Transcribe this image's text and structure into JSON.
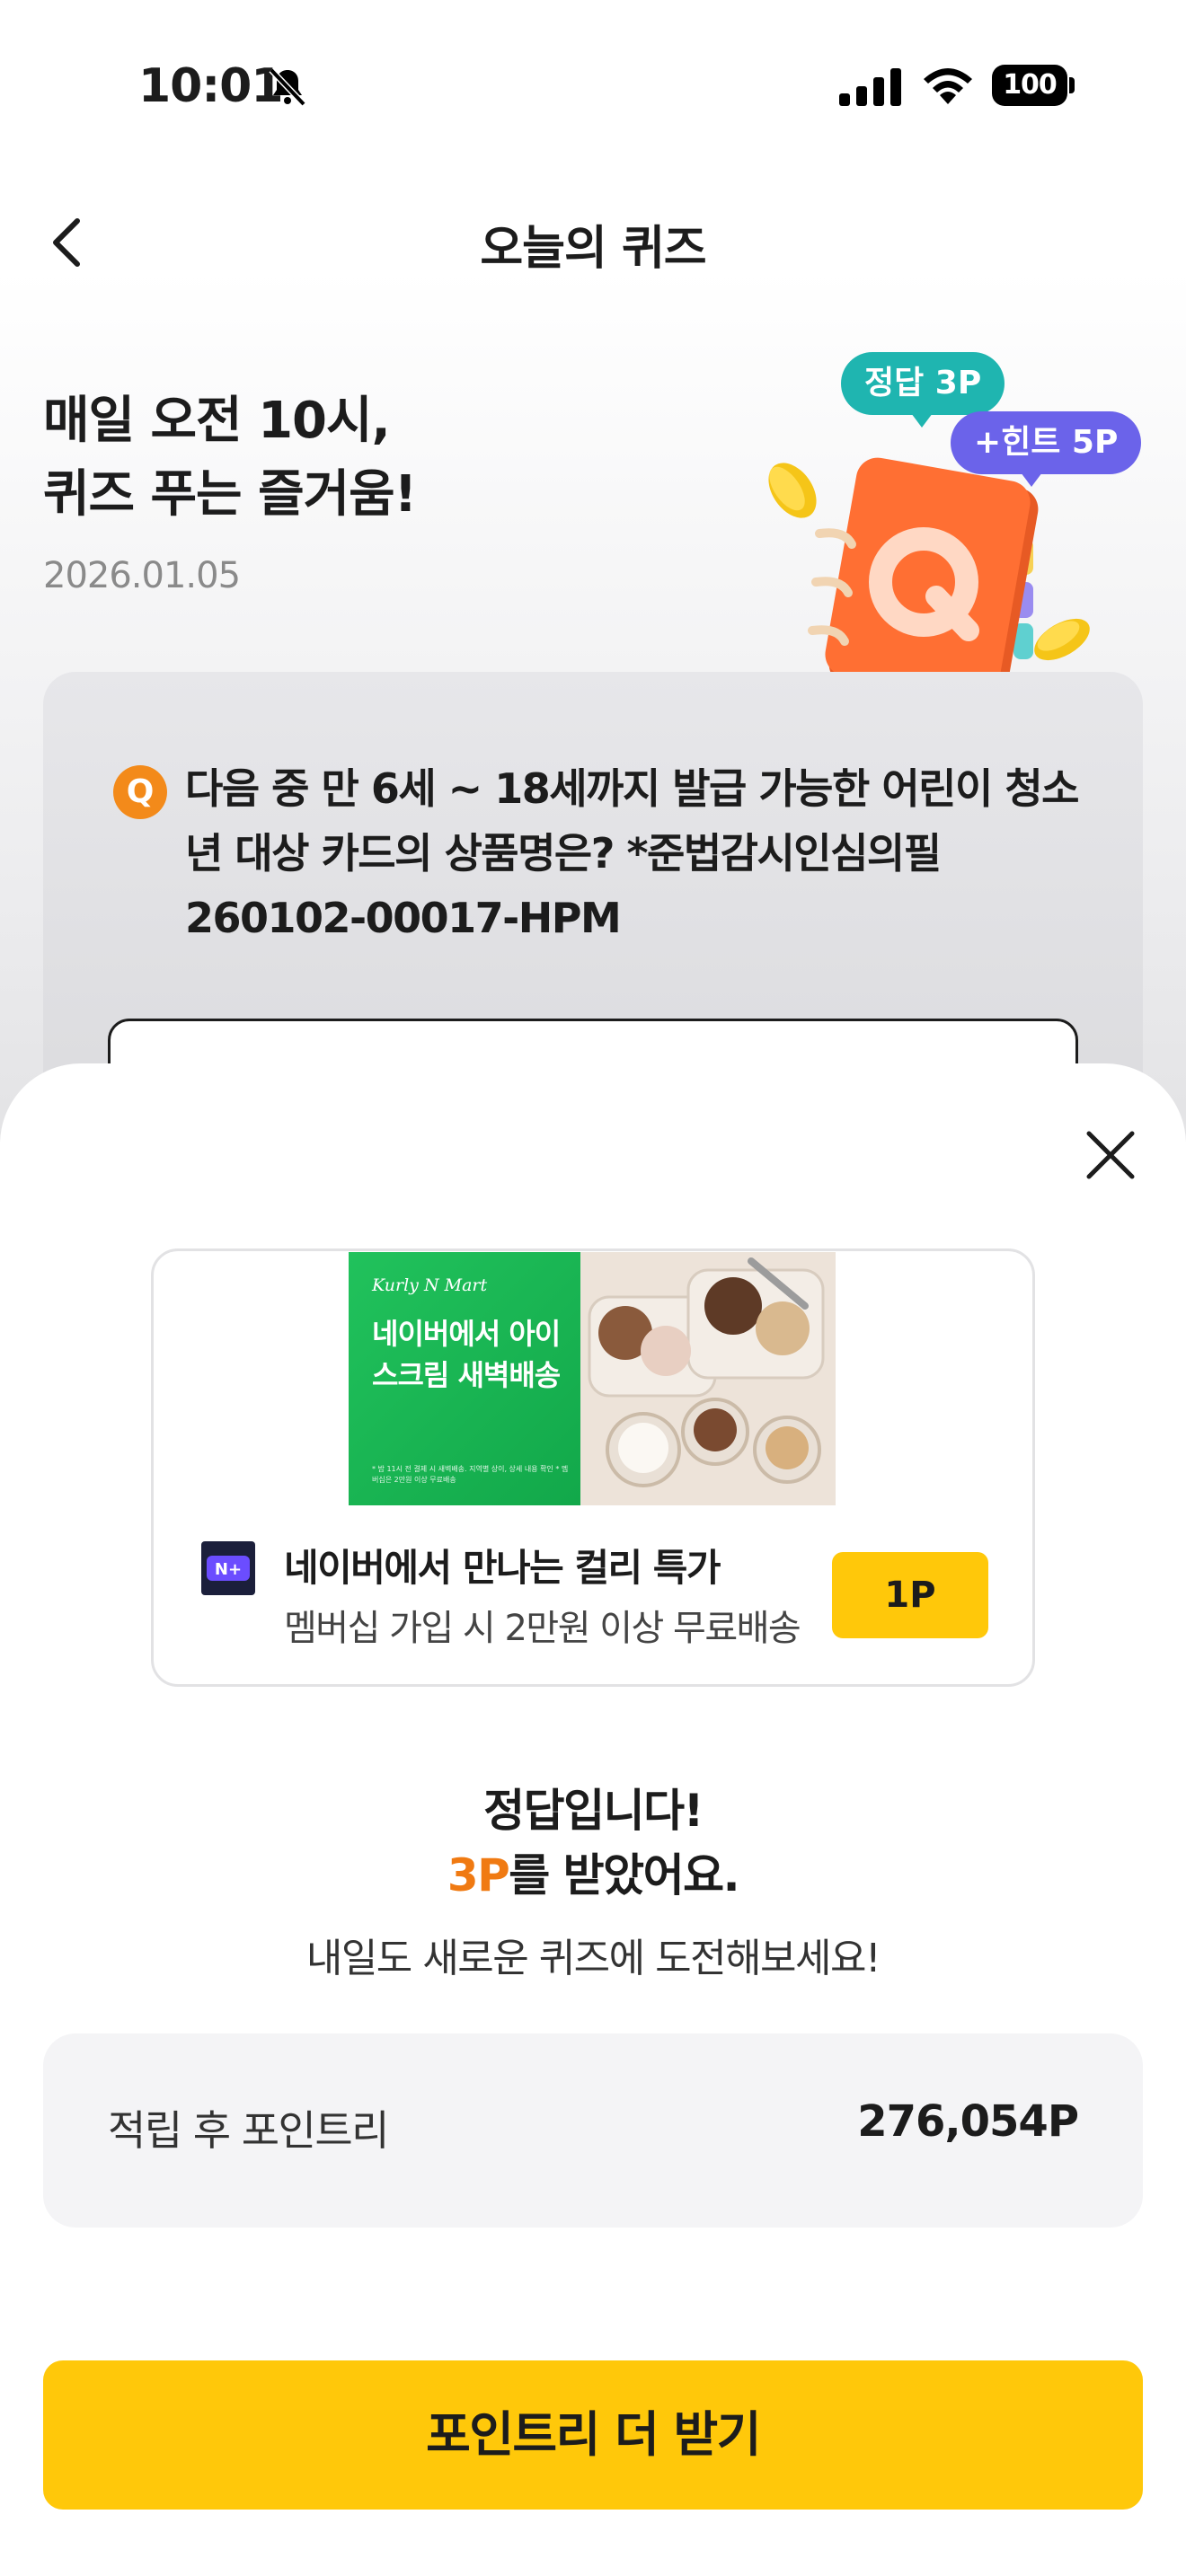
{
  "status_bar": {
    "time": "10:01",
    "battery": "100"
  },
  "header": {
    "title": "오늘의 퀴즈"
  },
  "hero": {
    "title_line1": "매일 오전 10시,",
    "title_line2": "퀴즈 푸는 즐거움!",
    "date": "2026.01.05",
    "badge_answer": "정답 3P",
    "badge_hint": "+힌트 5P"
  },
  "quiz": {
    "badge": "Q",
    "question": "다음 중 만 6세 ~ 18세까지 발급 가능한 어린이 청소년 대상 카드의 상품명은? *준법감시인심의필 260102-00017-HPM"
  },
  "ad": {
    "banner_brand": "Kurly N Mart",
    "banner_headline": "네이버에서 아이스크림 새벽배송",
    "banner_fineprint": "* 밤 11시 전 결제 시 새벽배송. 지역별 상이, 상세 내용 확인 * 멤버십은 2만원 이상 무료배송",
    "logo_text": "N+",
    "title": "네이버에서 만나는 컬리 특가",
    "description": "멤버십 가입 시 2만원 이상 무료배송",
    "point_label": "1P"
  },
  "result": {
    "title": "정답입니다!",
    "points": "3P",
    "points_suffix": "를 받았어요.",
    "subtitle": "내일도 새로운 퀴즈에 도전해보세요!"
  },
  "balance": {
    "label": "적립 후 포인트리",
    "value": "276,054P"
  },
  "cta": {
    "label": "포인트리 더 받기"
  },
  "colors": {
    "accent_yellow": "#ffc80a",
    "points_orange": "#f07a12",
    "answer_badge": "#1fb5b0",
    "hint_badge": "#6b63ea"
  },
  "icons": [
    "bell-slash-icon",
    "signal-icon",
    "wifi-icon",
    "back-chevron-icon",
    "close-icon",
    "quiz-notebook-illustration"
  ]
}
